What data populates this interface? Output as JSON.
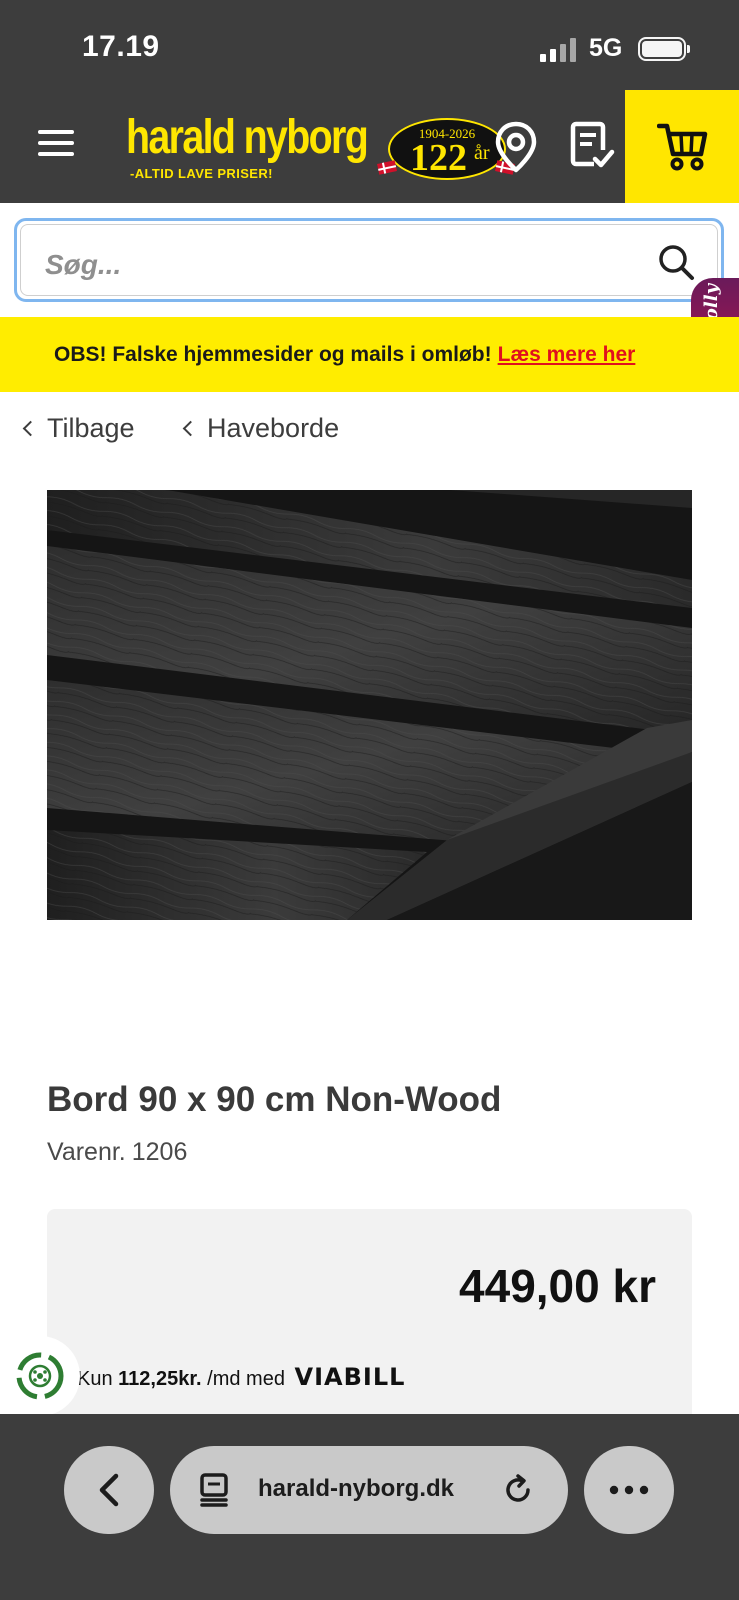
{
  "status_bar": {
    "time": "17.19",
    "network": "5G",
    "icons": [
      "signal-icon",
      "battery-icon"
    ]
  },
  "header": {
    "logo_name": "harald nyborg",
    "logo_tagline": "-ALTID LAVE PRISER!",
    "anniversary_years": "1904-2026",
    "anniversary_number": "122",
    "anniversary_unit": "år",
    "icons": [
      "menu-icon",
      "store-location-icon",
      "shopping-list-icon",
      "cart-icon"
    ]
  },
  "search": {
    "placeholder": "Søg..."
  },
  "chat_widget": {
    "label": "Molly"
  },
  "notice": {
    "text": "OBS! Falske hjemmesider og mails i omløb!",
    "link": "Læs mere her",
    "background": "#ffed00",
    "link_color": "#e0101e"
  },
  "breadcrumb": {
    "back": "Tilbage",
    "category": "Haveborde"
  },
  "product": {
    "title": "Bord 90 x 90 cm Non-Wood",
    "sku_label": "Varenr.",
    "sku": "1206",
    "price": "449,00 kr",
    "finance_prefix": "Kun",
    "finance_amount": "112,25kr.",
    "finance_suffix": "/md med",
    "finance_provider": "VIABILL",
    "image_alt": "dark slatted table top"
  },
  "browser": {
    "url": "harald-nyborg.dk",
    "icons": [
      "back-icon",
      "tab-icon",
      "reload-icon",
      "more-icon"
    ]
  },
  "colors": {
    "header_bg": "#3d3d3d",
    "brand_yellow": "#ffe600",
    "search_focus": "#7fb6ef"
  }
}
